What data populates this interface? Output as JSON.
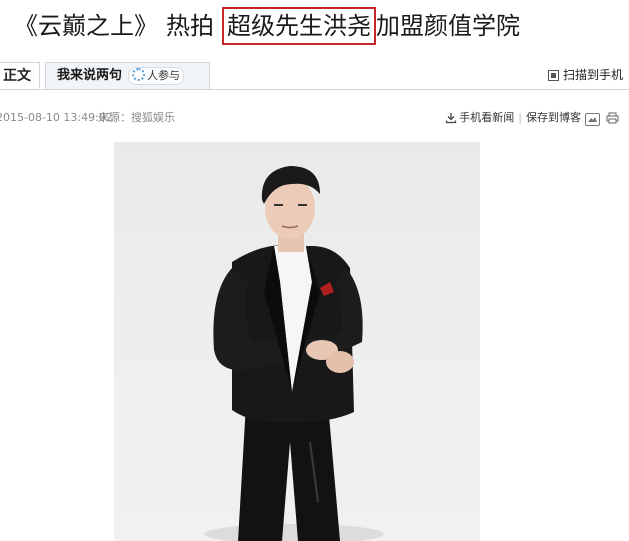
{
  "headline": {
    "part1": "《云巅之上》",
    "part2": "热拍",
    "highlighted": "超级先生洪尧",
    "part3": "加盟颜值学院",
    "highlight_color": "#c8242a"
  },
  "tabs": {
    "main_label": "正文",
    "comment_label": "我来说两句",
    "participants_label": "人参与",
    "scan_label": "扫描到手机"
  },
  "meta": {
    "datetime": "2015-08-10 13:49:02",
    "source": "来源：搜狐娱乐",
    "mobile_news": "手机看新闻",
    "save_blog": "保存到博客"
  },
  "icons": {
    "download": "download-icon",
    "qr": "qr-code-icon",
    "loading": "loading-spinner-icon",
    "image": "image-icon",
    "print": "print-icon"
  }
}
